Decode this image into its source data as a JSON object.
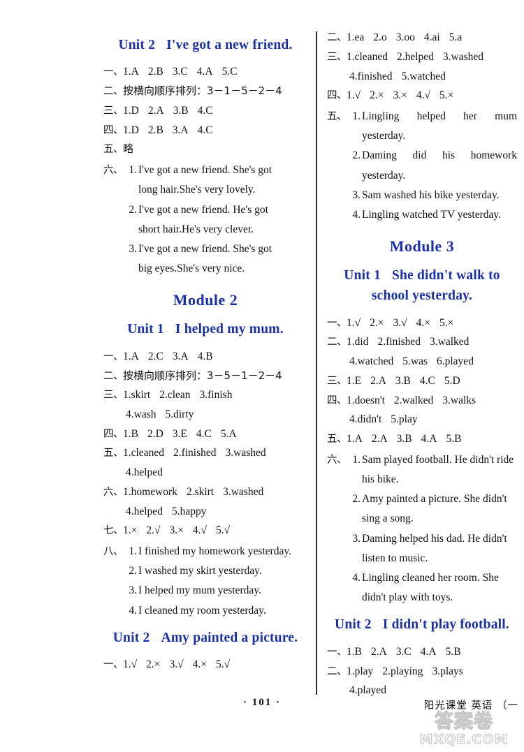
{
  "page": {
    "number": "· 101 ·",
    "book_line": "阳光课堂  英语  （一",
    "watermark_cn": "答案卷",
    "watermark_en": "MXQE.COM",
    "heading_color": "#1931a8"
  },
  "left_column": {
    "blocks": [
      {
        "kind": "unit_head",
        "num": "Unit 2",
        "title": "I've got a new friend."
      },
      {
        "kind": "answers",
        "lines": [
          {
            "marker": "一、",
            "items": [
              "1.A",
              "2.B",
              "3.C",
              "4.A",
              "5.C"
            ]
          },
          {
            "marker": "二、",
            "items": [
              "按横向顺序排列：3－1－5－2－4"
            ],
            "chinese": true
          },
          {
            "marker": "三、",
            "items": [
              "1.D",
              "2.A",
              "3.B",
              "4.C"
            ]
          },
          {
            "marker": "四、",
            "items": [
              "1.D",
              "2.B",
              "3.A",
              "4.C"
            ]
          },
          {
            "marker": "五、",
            "items": [
              "略"
            ],
            "chinese": true
          }
        ]
      },
      {
        "kind": "sentences",
        "marker": "六、",
        "entries": [
          {
            "num": "1.",
            "lines": [
              "I've got a new friend. She's got",
              "long hair.She's very lovely."
            ]
          },
          {
            "num": "2.",
            "lines": [
              "I've got a new friend. He's got",
              "short hair.He's very clever."
            ]
          },
          {
            "num": "3.",
            "lines": [
              "I've got a new friend. She's got",
              "big eyes.She's very nice."
            ]
          }
        ]
      },
      {
        "kind": "module_head",
        "title": "Module 2"
      },
      {
        "kind": "unit_head",
        "num": "Unit 1",
        "title": "I helped my mum."
      },
      {
        "kind": "answers",
        "lines": [
          {
            "marker": "一、",
            "items": [
              "1.A",
              "2.C",
              "3.A",
              "4.B"
            ]
          },
          {
            "marker": "二、",
            "items": [
              "按横向顺序排列：3－5－1－2－4"
            ],
            "chinese": true
          },
          {
            "marker": "三、",
            "items": [
              "1.skirt",
              "2.clean",
              "3.finish"
            ],
            "cont": [
              "4.wash",
              "5.dirty"
            ]
          },
          {
            "marker": "四、",
            "items": [
              "1.B",
              "2.D",
              "3.E",
              "4.C",
              "5.A"
            ]
          },
          {
            "marker": "五、",
            "items": [
              "1.cleaned",
              "2.finished",
              "3.washed"
            ],
            "cont": [
              "4.helped"
            ]
          },
          {
            "marker": "六、",
            "items": [
              "1.homework",
              "2.skirt",
              "3.washed"
            ],
            "cont": [
              "4.helped",
              "5.happy"
            ]
          },
          {
            "marker": "七、",
            "items": [
              "1.×",
              "2.√",
              "3.×",
              "4.√",
              "5.√"
            ]
          }
        ]
      },
      {
        "kind": "sentences",
        "marker": "八、",
        "entries": [
          {
            "num": "1.",
            "lines": [
              "I finished my homework yesterday."
            ]
          },
          {
            "num": "2.",
            "lines": [
              "I washed my skirt yesterday."
            ]
          },
          {
            "num": "3.",
            "lines": [
              "I helped my mum yesterday."
            ]
          },
          {
            "num": "4.",
            "lines": [
              "I cleaned my room yesterday."
            ]
          }
        ]
      },
      {
        "kind": "unit_head",
        "num": "Unit 2",
        "title": "Amy painted a picture."
      },
      {
        "kind": "answers",
        "lines": [
          {
            "marker": "一、",
            "items": [
              "1.√",
              "2.×",
              "3.√",
              "4.×",
              "5.√"
            ]
          }
        ]
      }
    ]
  },
  "right_column": {
    "blocks": [
      {
        "kind": "answers",
        "lines": [
          {
            "marker": "二、",
            "items": [
              "1.ea",
              "2.o",
              "3.oo",
              "4.ai",
              "5.a"
            ]
          },
          {
            "marker": "三、",
            "items": [
              "1.cleaned",
              "2.helped",
              "3.washed"
            ],
            "cont": [
              "4.finished",
              "5.watched"
            ]
          },
          {
            "marker": "四、",
            "items": [
              "1.√",
              "2.×",
              "3.×",
              "4.√",
              "5.×"
            ]
          }
        ]
      },
      {
        "kind": "sentences",
        "marker": "五、",
        "entries": [
          {
            "num": "1.",
            "lines": [
              "Lingling helped her mum yesterday."
            ]
          },
          {
            "num": "2.",
            "lines": [
              "Daming did his homework yesterday."
            ]
          },
          {
            "num": "3.",
            "lines": [
              "Sam washed his bike yesterday."
            ]
          },
          {
            "num": "4.",
            "lines": [
              "Lingling watched TV yesterday."
            ]
          }
        ]
      },
      {
        "kind": "module_head",
        "title": "Module 3"
      },
      {
        "kind": "unit_head",
        "num": "Unit 1",
        "title": "She didn't walk to school yesterday."
      },
      {
        "kind": "answers",
        "lines": [
          {
            "marker": "一、",
            "items": [
              "1.√",
              "2.×",
              "3.√",
              "4.×",
              "5.×"
            ]
          },
          {
            "marker": "二、",
            "items": [
              "1.did",
              "2.finished",
              "3.walked"
            ],
            "cont": [
              "4.watched",
              "5.was",
              "6.played"
            ]
          },
          {
            "marker": "三、",
            "items": [
              "1.E",
              "2.A",
              "3.B",
              "4.C",
              "5.D"
            ]
          },
          {
            "marker": "四、",
            "items": [
              "1.doesn't",
              "2.walked",
              "3.walks"
            ],
            "cont": [
              "4.didn't",
              "5.play"
            ]
          },
          {
            "marker": "五、",
            "items": [
              "1.A",
              "2.A",
              "3.B",
              "4.A",
              "5.B"
            ]
          }
        ]
      },
      {
        "kind": "sentences",
        "marker": "六、",
        "entries": [
          {
            "num": "1.",
            "lines": [
              "Sam played football. He didn't ride",
              "his bike."
            ]
          },
          {
            "num": "2.",
            "lines": [
              "Amy painted a picture. She didn't",
              "sing a song."
            ]
          },
          {
            "num": "3.",
            "lines": [
              "Daming helped his dad. He didn't",
              "listen to music."
            ]
          },
          {
            "num": "4.",
            "lines": [
              "Lingling cleaned her room. She",
              "didn't play with toys."
            ]
          }
        ]
      },
      {
        "kind": "unit_head",
        "num": "Unit 2",
        "title": "I didn't play football."
      },
      {
        "kind": "answers",
        "lines": [
          {
            "marker": "一、",
            "items": [
              "1.B",
              "2.A",
              "3.C",
              "4.A",
              "5.B"
            ]
          },
          {
            "marker": "二、",
            "items": [
              "1.play",
              "2.playing",
              "3.plays"
            ],
            "cont": [
              "4.played"
            ]
          }
        ]
      }
    ]
  }
}
